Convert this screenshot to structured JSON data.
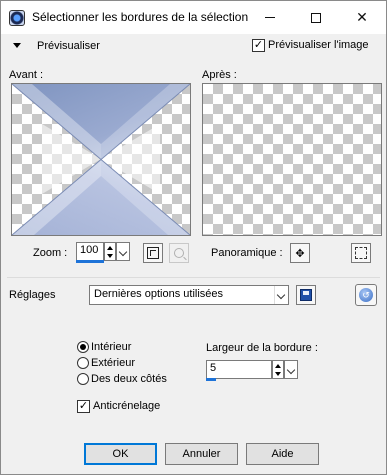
{
  "window": {
    "title": "Sélectionner les bordures de la sélection",
    "icon": "paint-shop-icon"
  },
  "preview": {
    "label": "Prévisualiser",
    "preview_image_label": "Prévisualiser l'image",
    "preview_image_checked": true
  },
  "panes": {
    "before_label": "Avant :",
    "after_label": "Après :"
  },
  "zoom": {
    "label": "Zoom :",
    "value": "100"
  },
  "pan": {
    "label": "Panoramique :"
  },
  "settings": {
    "label": "Réglages",
    "value": "Dernières options utilisées"
  },
  "options": {
    "inside_label": "Intérieur",
    "outside_label": "Extérieur",
    "both_label": "Des deux côtés",
    "selected": "inside",
    "border_width_label": "Largeur de la bordure :",
    "border_width_value": "5",
    "antialias_label": "Anticrénelage",
    "antialias_checked": true
  },
  "buttons": {
    "ok": "OK",
    "cancel": "Annuler",
    "help": "Aide"
  },
  "colors": {
    "accent": "#1e73d8",
    "preview_blue": "#8fa3c8"
  }
}
